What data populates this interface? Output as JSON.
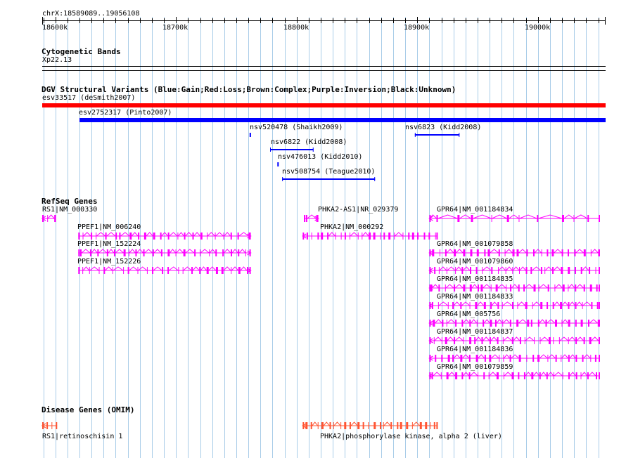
{
  "browser": {
    "location": "chrX:18589089..19056108",
    "colors": {
      "grid": "#a8cce8",
      "gene": "#ff00ff",
      "disease": "#ff5533",
      "gain": "#0000ff",
      "loss": "#ff0000"
    },
    "ruler": {
      "start": 18589089,
      "end": 19056108,
      "tick_labels": [
        "18600k",
        "18700k",
        "18800k",
        "18900k",
        "19000k"
      ]
    }
  },
  "tracks": {
    "cytoband": {
      "title": "Cytogenetic Bands",
      "band_label": "Xp22.13"
    },
    "dgv": {
      "title": "DGV Structural Variants (Blue:Gain;Red:Loss;Brown:Complex;Purple:Inversion;Black:Unknown)",
      "features": [
        {
          "label": "esv33517 (deSmith2007)",
          "start": 18589089,
          "end": 19056108,
          "type": "loss",
          "color": "#ff0000"
        },
        {
          "label": "esv2752317 (Pinto2007)",
          "start": 18620000,
          "end": 19056108,
          "type": "gain",
          "color": "#0000ff"
        },
        {
          "label": "nsv520478 (Shaikh2009)",
          "start": 18761000,
          "end": 18762500,
          "type": "gain",
          "color": "#0000ff"
        },
        {
          "label": "nsv6823 (Kidd2008)",
          "start": 18898000,
          "end": 18935000,
          "type": "gain",
          "color": "#0000ff"
        },
        {
          "label": "nsv6822 (Kidd2008)",
          "start": 18778000,
          "end": 18814000,
          "type": "gain",
          "color": "#0000ff"
        },
        {
          "label": "nsv476013 (Kidd2010)",
          "start": 18784000,
          "end": 18785500,
          "type": "gain",
          "color": "#0000ff"
        },
        {
          "label": "nsv508754 (Teague2010)",
          "start": 18788000,
          "end": 18865000,
          "type": "gain",
          "color": "#0000ff"
        }
      ]
    },
    "refseq": {
      "title": "RefSeq Genes",
      "genes": [
        {
          "label": "RS1|NM_000330",
          "start": 18589089,
          "end": 18600500,
          "strand": "-"
        },
        {
          "label": "PHKA2-AS1|NR_029379",
          "start": 18806000,
          "end": 18818000,
          "strand": "+"
        },
        {
          "label": "GPR64|NM_001184834",
          "start": 18910000,
          "end": 19054000,
          "strand": "-"
        },
        {
          "label": "PPEF1|NM_006240",
          "start": 18619000,
          "end": 18762000,
          "strand": "+"
        },
        {
          "label": "PHKA2|NM_000292",
          "start": 18805000,
          "end": 18917000,
          "strand": "-"
        },
        {
          "label": "PPEF1|NM_152224",
          "start": 18619000,
          "end": 18762000,
          "strand": "+"
        },
        {
          "label": "GPR64|NM_001079858",
          "start": 18910000,
          "end": 19054000,
          "strand": "-"
        },
        {
          "label": "PPEF1|NM_152226",
          "start": 18619000,
          "end": 18762000,
          "strand": "+"
        },
        {
          "label": "GPR64|NM_001079860",
          "start": 18910000,
          "end": 19054000,
          "strand": "-"
        },
        {
          "label": "GPR64|NM_001184835",
          "start": 18910000,
          "end": 19054000,
          "strand": "-"
        },
        {
          "label": "GPR64|NM_001184833",
          "start": 18910000,
          "end": 19054000,
          "strand": "-"
        },
        {
          "label": "GPR64|NM_005756",
          "start": 18910000,
          "end": 19054000,
          "strand": "-"
        },
        {
          "label": "GPR64|NM_001184837",
          "start": 18910000,
          "end": 19054000,
          "strand": "-"
        },
        {
          "label": "GPR64|NM_001184836",
          "start": 18910000,
          "end": 19054000,
          "strand": "-"
        },
        {
          "label": "GPR64|NM_001079859",
          "start": 18910000,
          "end": 19054000,
          "strand": "-"
        }
      ]
    },
    "disease": {
      "title": "Disease Genes (OMIM)",
      "genes": [
        {
          "label": "RS1|retinoschisin 1",
          "start": 18589089,
          "end": 18601500,
          "strand": "-"
        },
        {
          "label": "PHKA2|phosphorylase kinase, alpha 2 (liver)",
          "start": 18805000,
          "end": 18917000,
          "strand": "-"
        }
      ]
    }
  }
}
